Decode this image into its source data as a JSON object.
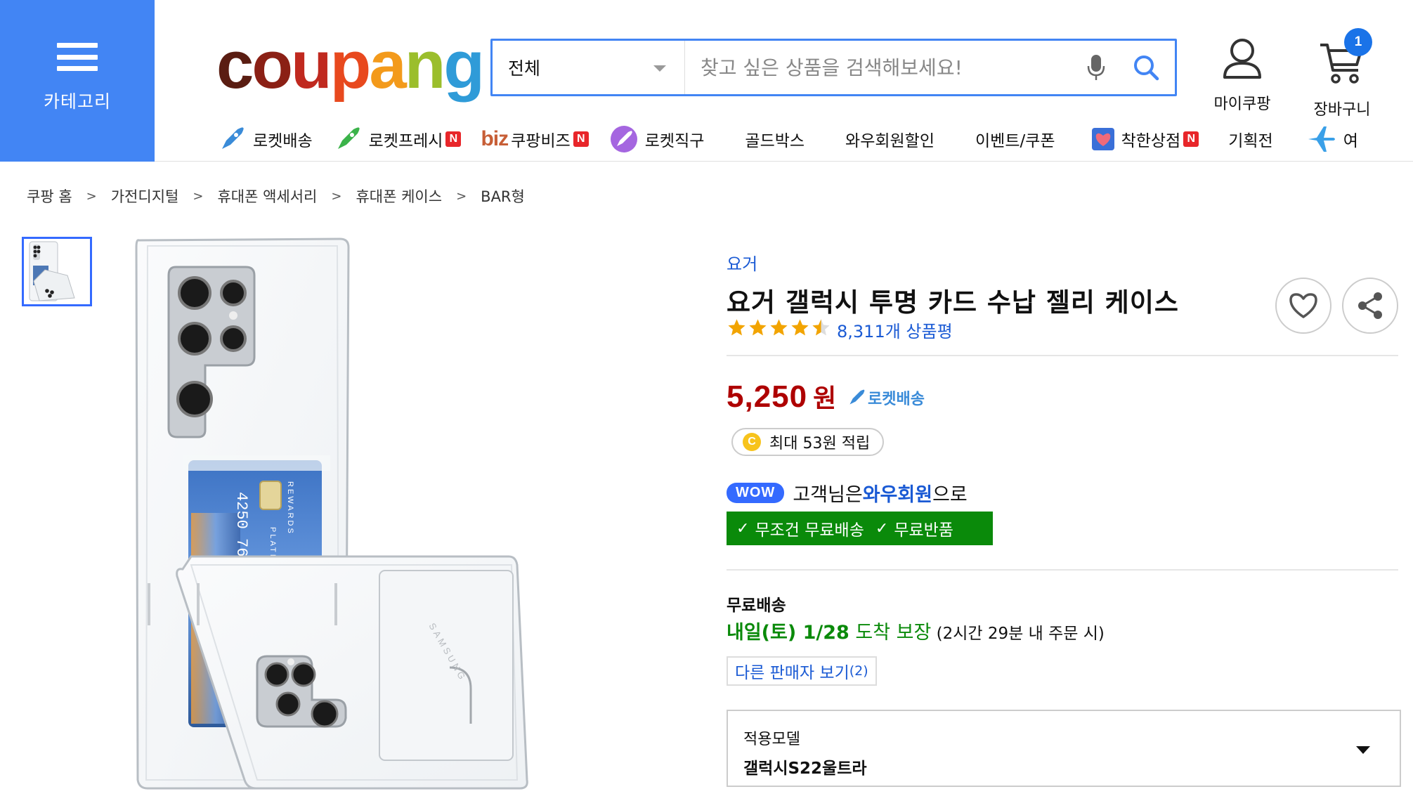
{
  "header": {
    "category_label": "카테고리",
    "logo_text": [
      "c",
      "o",
      "u",
      "p",
      "a",
      "n",
      "g"
    ],
    "search": {
      "scope": "전체",
      "placeholder": "찾고 싶은 상품을 검색해보세요!"
    },
    "mycoupang_label": "마이쿠팡",
    "cart_label": "장바구니",
    "cart_count": "1"
  },
  "nav": {
    "rocket_delivery": "로켓배송",
    "rocket_fresh": "로켓프레시",
    "biz_logo": "biz",
    "coupang_biz": "쿠팡비즈",
    "rocket_direct": "로켓직구",
    "goldbox": "골드박스",
    "wow_discount": "와우회원할인",
    "events": "이벤트/쿠폰",
    "good_store": "착한상점",
    "special": "기획전",
    "travel": "여",
    "new_badge": "N"
  },
  "breadcrumb": [
    "쿠팡 홈",
    "가전디지털",
    "휴대폰 액세서리",
    "휴대폰 케이스",
    "BAR형"
  ],
  "breadcrumb_sep": ">",
  "product": {
    "brand": "요거",
    "title": "요거 갤럭시 투명 카드 수납 젤리 케이스",
    "rating": 4.5,
    "review_text": "8,311개 상품평",
    "price": "5,250",
    "price_unit": "원",
    "rocket_tag": "로켓배송",
    "points_text": "최대 53원 적립",
    "coin_letter": "C",
    "wow_badge": "WOW",
    "wow_prefix": "고객님은 ",
    "wow_member": "와우회원",
    "wow_suffix": "으로",
    "free_ship": "무조건 무료배송",
    "free_return": "무료반품",
    "shipping_title": "무료배송",
    "delivery_day": "내일(토) 1/28",
    "delivery_guarantee": " 도착 보장",
    "delivery_condition": " (2시간 29분 내 주문 시)",
    "other_sellers": "다른 판매자 보기",
    "other_sellers_count": "(2)",
    "option_label": "적용모델",
    "option_value": "갤럭시S22울트라"
  },
  "card_texts": {
    "numbers": "4250 7681",
    "rewards": "REWARDS",
    "platinum": "PLATINUM",
    "samsung": "SAMSUNG"
  },
  "colors": {
    "accent": "#4285f4",
    "price": "#ae0000",
    "link": "#1a5ad4",
    "free_bar": "#0a8a0a"
  }
}
